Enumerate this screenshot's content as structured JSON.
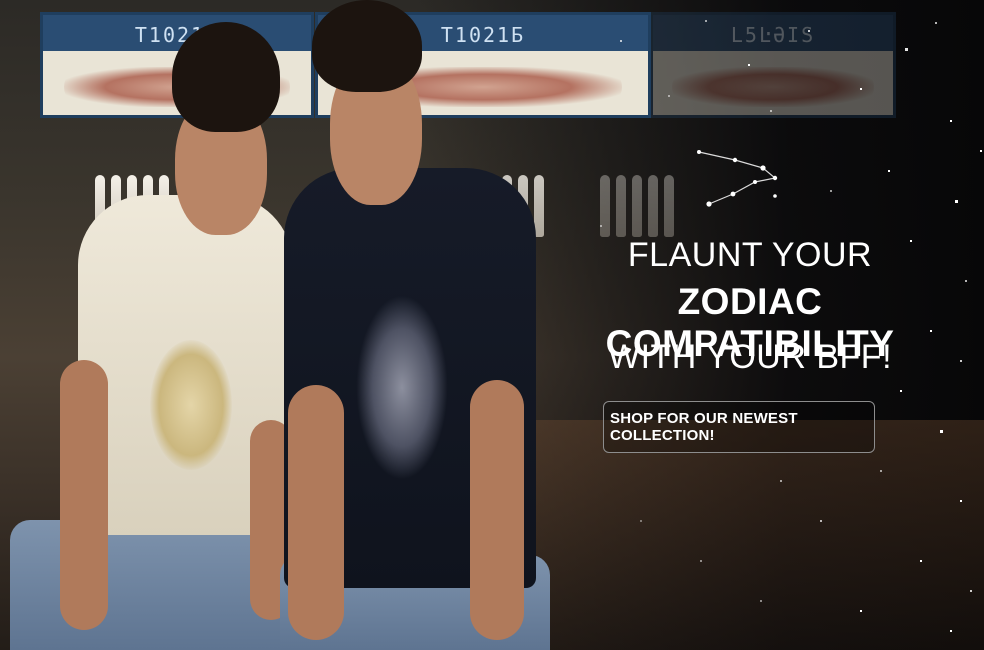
{
  "hero": {
    "headline_line1": "FLAUNT YOUR",
    "headline_line2": "ZODIAC COMPATIBILITY",
    "headline_line3": "WITH YOUR BFF!",
    "cta_label": "SHOP FOR OUR NEWEST COLLECTION!",
    "decorative_icon": "constellation-icon",
    "colors": {
      "headline_text": "#ffffff",
      "cta_border": "#8d8d8d",
      "background_dark": "#070708"
    }
  },
  "scene": {
    "lane_codes": [
      "T1021Б",
      "T1021Б",
      "L5ĿƏIS"
    ],
    "left_shirt_print_icon": "lion-icon",
    "right_shirt_print_icon": "scorpion-icon"
  }
}
